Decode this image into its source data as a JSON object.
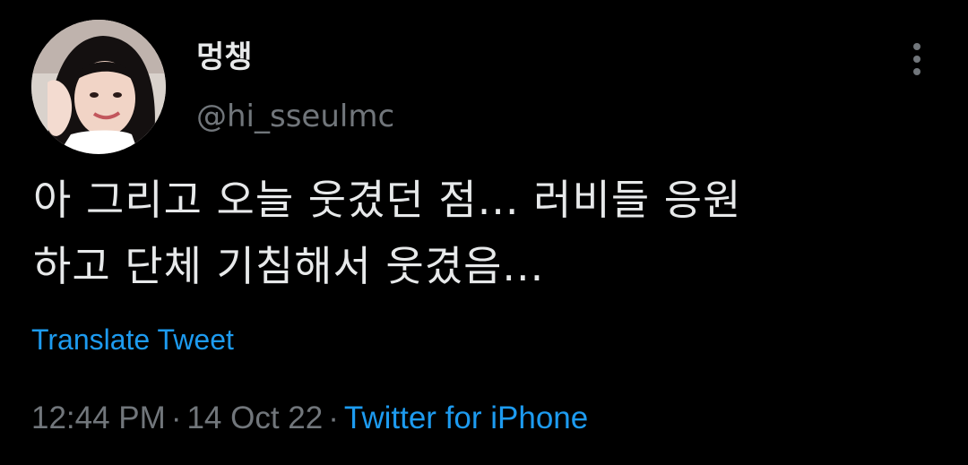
{
  "tweet": {
    "author": {
      "display_name": "멍챙",
      "handle": "@hi_sseulmc",
      "avatar_icon": "profile-photo"
    },
    "more_icon": "more-vertical-icon",
    "text_lines": [
      "아 그리고 오늘 웃겼던 점... 러비들 응원",
      "하고 단체 기침해서 웃겼음..."
    ],
    "translate_label": "Translate Tweet",
    "time": "12:44 PM",
    "separator": "·",
    "date": "14 Oct 22",
    "source": "Twitter for iPhone"
  },
  "colors": {
    "background": "#000000",
    "primary_text": "#e7e9ea",
    "secondary_text": "#71767b",
    "link": "#1d9bf0"
  }
}
